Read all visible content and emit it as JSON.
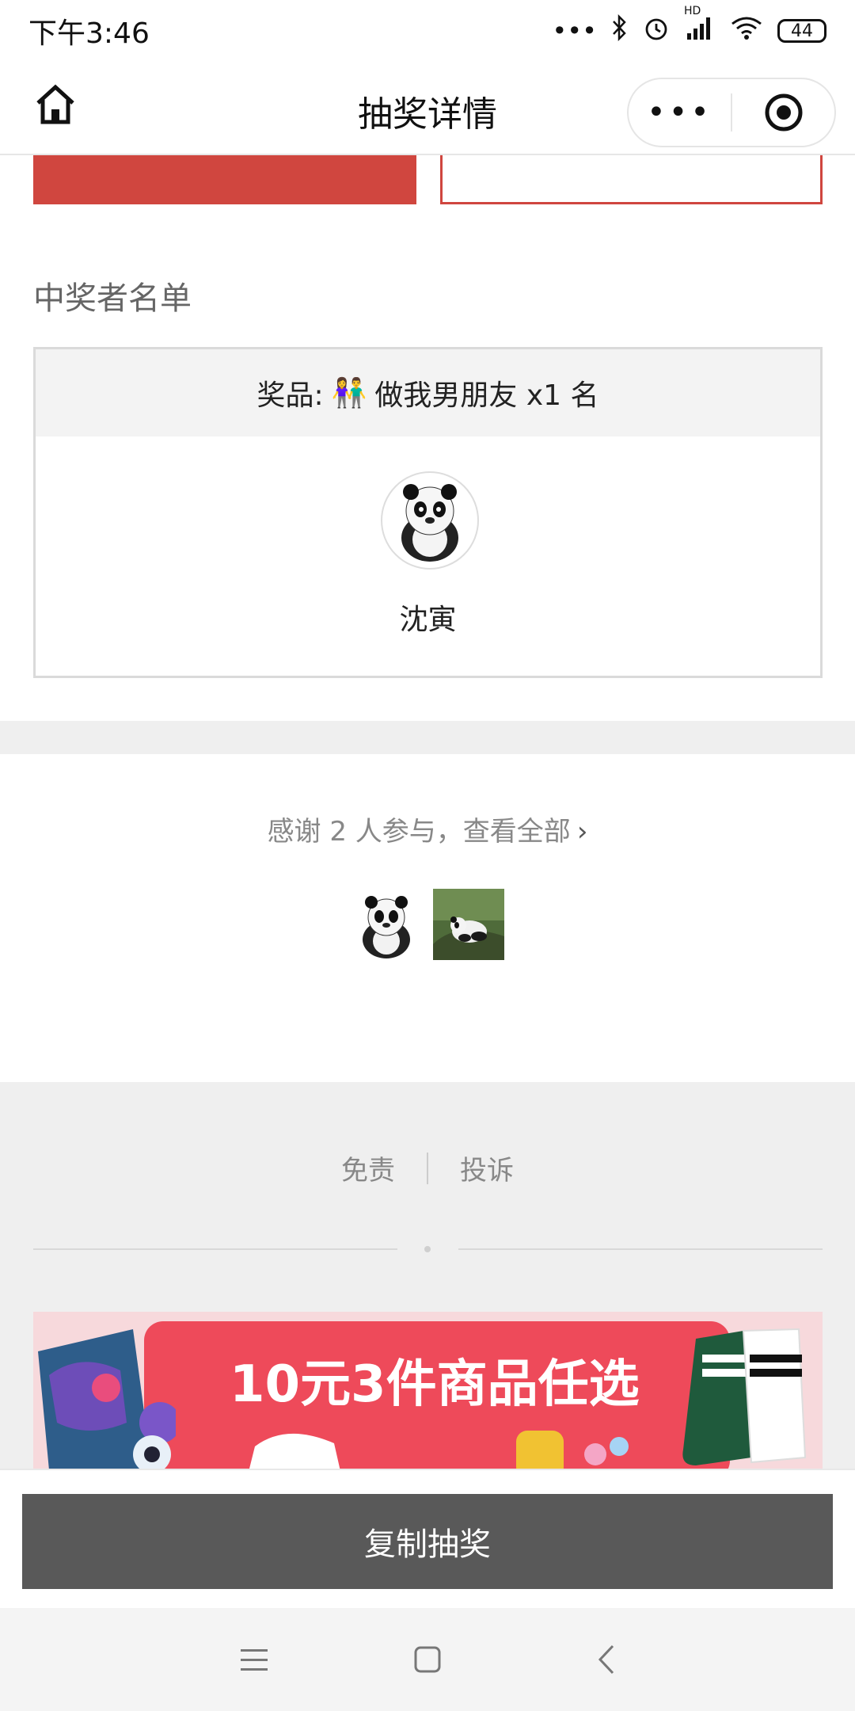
{
  "status_bar": {
    "time": "下午3:46",
    "network_badge": "HD",
    "battery": "44",
    "icons": [
      "more-dots-icon",
      "bluetooth-icon",
      "alarm-icon",
      "signal-icon",
      "wifi-icon",
      "battery-icon"
    ]
  },
  "nav": {
    "title": "抽奖详情",
    "more_label": "•••",
    "icons": [
      "home-icon",
      "more-icon",
      "close-target-icon"
    ]
  },
  "top_buttons": {
    "left_label": "",
    "right_label": ""
  },
  "winners": {
    "section_title": "中奖者名单",
    "prize_label": "奖品:",
    "prize_emoji": "👫",
    "prize_name": "做我男朋友 x1 名",
    "winner_name": "沈寅"
  },
  "participants": {
    "thanks_text": "感谢 2 人参与，查看全部",
    "chevron": "›",
    "count": 2
  },
  "footer": {
    "disclaimer": "免责",
    "complaint": "投诉"
  },
  "ad": {
    "headline": "10元3件商品任选",
    "colors": {
      "bg": "#f7d9dc",
      "banner": "#ee4a5a"
    }
  },
  "bottom": {
    "copy_button": "复制抽奖"
  },
  "colors": {
    "accent_red": "#d0463f",
    "button_gray": "#595959",
    "background_gray": "#efefef"
  }
}
